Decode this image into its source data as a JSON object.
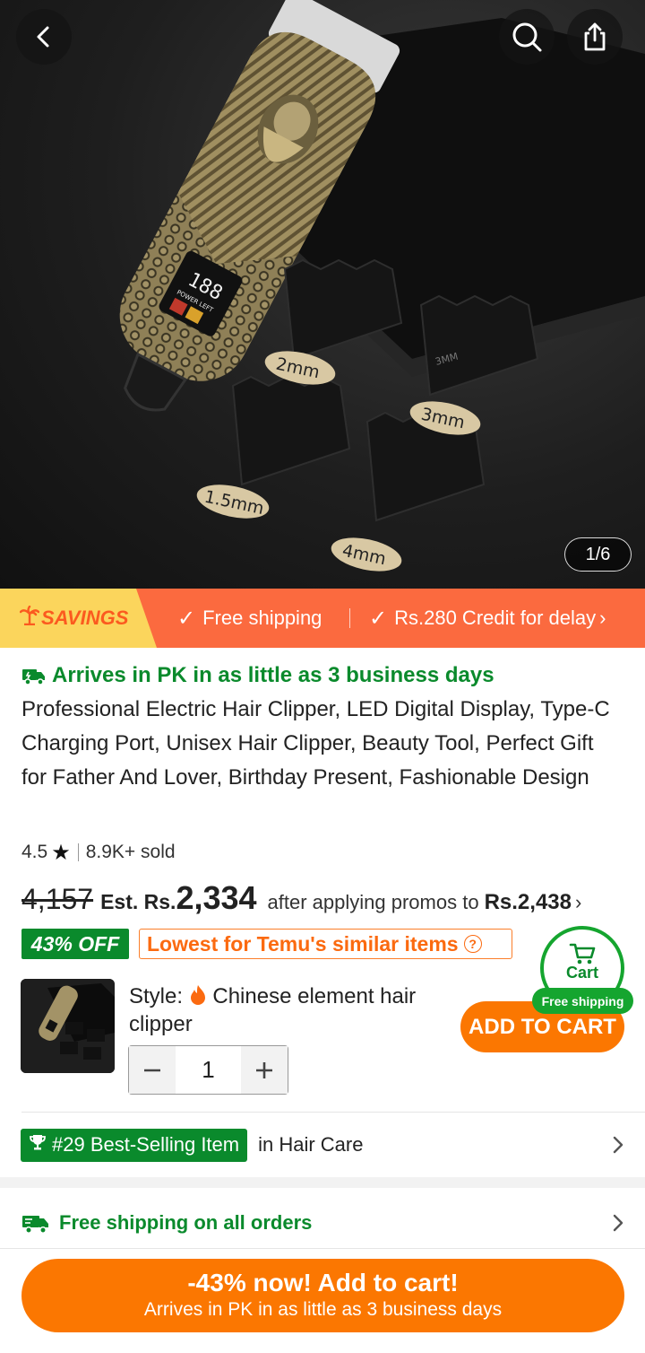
{
  "hero": {
    "page_indicator": "1/6",
    "guide_labels": [
      "2mm",
      "3mm",
      "1.5mm",
      "4mm"
    ],
    "display_digits": "188",
    "display_caption": "POWER LEFT",
    "guide_mark": "3MM"
  },
  "savings_bar": {
    "tag": "SAVINGS",
    "free_shipping": "Free shipping",
    "credit": "Rs.280 Credit for delay"
  },
  "product": {
    "arrives": "Arrives in PK in as little as 3 business days",
    "title": "Professional Electric Hair Clipper, LED Digital Display, Type-C Charging Port, Unisex Hair Clipper, Beauty Tool, Perfect Gift for Father And Lover, Birthday Present, Fashionable Design",
    "rating": "4.5",
    "sold": "8.9K+ sold",
    "original_price": "4,157",
    "est_label": "Est. Rs.",
    "est_price": "2,334",
    "promo_text": "after applying promos to",
    "promo_price": "Rs.2,438",
    "off_badge": "43% OFF",
    "lowest_badge": "Lowest for Temu's similar items"
  },
  "style": {
    "label": "Style:",
    "value": "Chinese element hair clipper",
    "quantity": "1"
  },
  "cart": {
    "label": "Cart",
    "free_shipping": "Free shipping",
    "add_to_cart": "ADD TO CART"
  },
  "best_selling": {
    "badge": "#29 Best-Selling Item",
    "category": "in Hair Care"
  },
  "shipping": {
    "text": "Free shipping on all orders"
  },
  "bottom_cta": {
    "line1": "-43% now! Add to cart!",
    "line2": "Arrives in PK in as little as 3 business days"
  },
  "colors": {
    "accent_orange": "#fb7701",
    "savings_bar": "#fb6a3f",
    "savings_tag": "#fbd55c",
    "green": "#0a8a2c"
  },
  "icons": [
    "back-icon",
    "search-icon",
    "share-icon",
    "check-icon",
    "delivery-truck-icon",
    "star-icon",
    "help-icon",
    "flame-icon",
    "cart-icon",
    "trophy-icon",
    "chevron-right-icon",
    "minus-icon",
    "plus-icon",
    "palm-tree-icon"
  ]
}
